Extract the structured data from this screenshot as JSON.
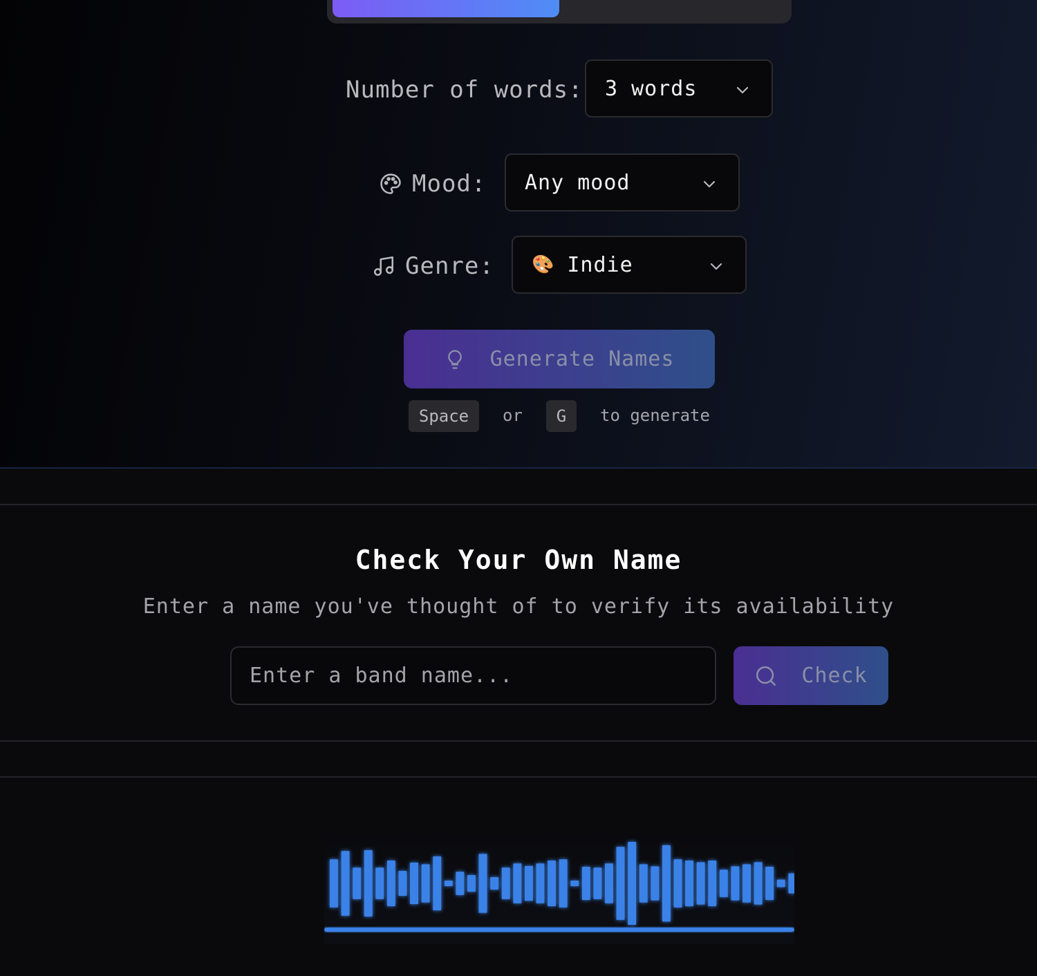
{
  "controls": {
    "words_label": "Number of words:",
    "words_value": "3 words",
    "mood_label": "Mood:",
    "mood_value": "Any mood",
    "genre_label": "Genre:",
    "genre_emoji": "🎨",
    "genre_value": "Indie",
    "generate_label": "Generate Names",
    "hint": {
      "key1": "Space",
      "or": "or",
      "key2": "G",
      "suffix": "to generate"
    }
  },
  "check_section": {
    "title": "Check Your Own Name",
    "subtitle": "Enter a name you've thought of to verify its availability",
    "input_placeholder": "Enter a band name...",
    "button_label": "Check"
  },
  "waveform": {
    "color": "#3b82e8",
    "levels": [
      0.58,
      0.78,
      0.38,
      0.8,
      0.38,
      0.55,
      0.3,
      0.5,
      0.46,
      0.65,
      0.05,
      0.28,
      0.2,
      0.71,
      0.15,
      0.38,
      0.48,
      0.42,
      0.48,
      0.55,
      0.58,
      0.05,
      0.4,
      0.38,
      0.48,
      0.88,
      1.0,
      0.46,
      0.41,
      0.92,
      0.58,
      0.55,
      0.51,
      0.55,
      0.33,
      0.41,
      0.46,
      0.51,
      0.4,
      0.09,
      0.24
    ]
  },
  "colors": {
    "accent_start": "#7c5cf5",
    "accent_end": "#4f8df6",
    "background": "#0a0a0d"
  }
}
